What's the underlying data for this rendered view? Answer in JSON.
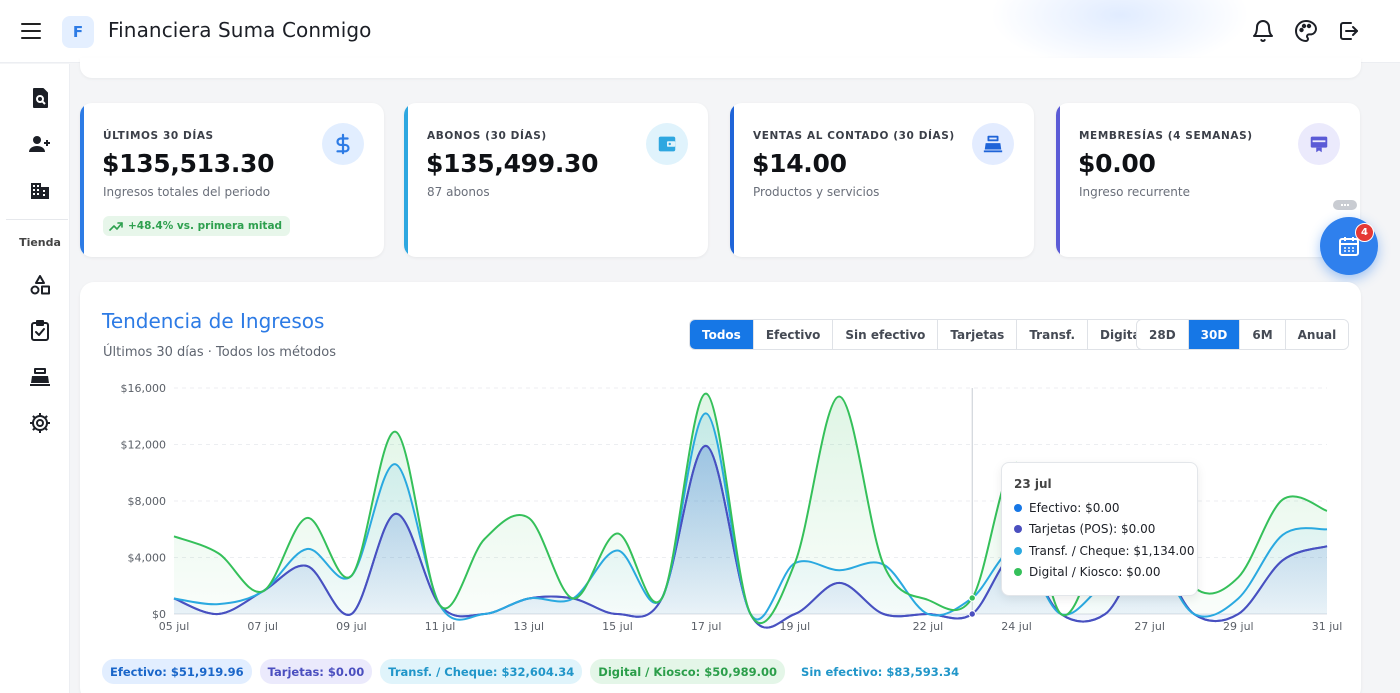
{
  "app": {
    "logo_letter": "F",
    "title": "Financiera Suma Conmigo"
  },
  "topbar": {
    "icons": [
      "bell-icon",
      "palette-icon",
      "logout-icon"
    ]
  },
  "sidebar": {
    "items_top": [
      "search-document-icon",
      "add-user-icon",
      "building-icon"
    ],
    "section_label": "Tienda",
    "items_store": [
      "shapes-icon",
      "clipboard-check-icon",
      "cash-register-icon",
      "gear-icon"
    ]
  },
  "kpis": [
    {
      "label": "ÚLTIMOS 30 DÍAS",
      "value": "$135,513.30",
      "sub": "Ingresos totales del periodo",
      "trend": "+48.4% vs. primera mitad",
      "accent": "#2d7be5",
      "icon": "dollar-icon",
      "icon_bg": "#e2eeff",
      "icon_color": "#2d7be5"
    },
    {
      "label": "ABONOS (30 DÍAS)",
      "value": "$135,499.30",
      "sub": "87 abonos",
      "accent": "#2ea7e0",
      "icon": "wallet-icon",
      "icon_bg": "#e0f3fc",
      "icon_color": "#2ea7e0"
    },
    {
      "label": "VENTAS AL CONTADO (30 DÍAS)",
      "value": "$14.00",
      "sub": "Productos y servicios",
      "accent": "#1f64d8",
      "icon": "cash-register-icon",
      "icon_bg": "#e3ecff",
      "icon_color": "#1f64d8"
    },
    {
      "label": "MEMBRESÍAS (4 SEMANAS)",
      "value": "$0.00",
      "sub": "Ingreso recurrente",
      "accent": "#5b5bd6",
      "icon": "card-icon",
      "icon_bg": "#ebeafc",
      "icon_color": "#5b5bd6"
    }
  ],
  "fab": {
    "badge": "4",
    "icon": "calendar-icon"
  },
  "chart": {
    "title": "Tendencia de Ingresos",
    "subtitle": "Últimos 30 días · Todos los métodos",
    "filters": [
      "Todos",
      "Efectivo",
      "Sin efectivo",
      "Tarjetas",
      "Transf.",
      "Digital"
    ],
    "filter_active": "Todos",
    "ranges": [
      "28D",
      "30D",
      "6M",
      "Anual"
    ],
    "range_active": "30D",
    "tooltip": {
      "title": "23 jul",
      "rows": [
        {
          "label": "Efectivo: $0.00",
          "color": "#1677e6"
        },
        {
          "label": "Tarjetas (POS): $0.00",
          "color": "#4b4fbf"
        },
        {
          "label": "Transf. / Cheque: $1,134.00",
          "color": "#2aa9e0"
        },
        {
          "label": "Digital / Kiosco: $0.00",
          "color": "#35c05a"
        }
      ]
    },
    "chips": [
      {
        "label": "Efectivo: $51,919.96",
        "bg": "#e2eeff",
        "color": "#1a66c9"
      },
      {
        "label": "Tarjetas: $0.00",
        "bg": "#ebeafc",
        "color": "#4b4fbf"
      },
      {
        "label": "Transf. / Cheque: $32,604.34",
        "bg": "#e0f4fb",
        "color": "#2196c9"
      },
      {
        "label": "Digital / Kiosco: $50,989.00",
        "bg": "#e4f6e8",
        "color": "#2b9e4a"
      },
      {
        "label": "Sin efectivo: $83,593.34",
        "bg": "#ffffff",
        "color": "#2196c9"
      }
    ]
  },
  "chart_data": {
    "type": "area",
    "x": [
      "05 jul",
      "06 jul",
      "07 jul",
      "08 jul",
      "09 jul",
      "10 jul",
      "11 jul",
      "12 jul",
      "13 jul",
      "14 jul",
      "15 jul",
      "16 jul",
      "17 jul",
      "18 jul",
      "19 jul",
      "20 jul",
      "21 jul",
      "22 jul",
      "23 jul",
      "24 jul",
      "25 jul",
      "26 jul",
      "27 jul",
      "28 jul",
      "29 jul",
      "30 jul",
      "31 jul"
    ],
    "xticks": [
      "05 jul",
      "07 jul",
      "09 jul",
      "11 jul",
      "13 jul",
      "15 jul",
      "17 jul",
      "19 jul",
      "22 jul",
      "24 jul",
      "27 jul",
      "29 jul",
      "31 jul"
    ],
    "yticks": [
      "$0",
      "$4,000",
      "$8,000",
      "$12,000",
      "$16,000"
    ],
    "ylim": [
      0,
      16000
    ],
    "grid": true,
    "stacked": true,
    "series": [
      {
        "name": "Efectivo",
        "color": "#1677e6",
        "values": [
          1100,
          0,
          1600,
          3400,
          0,
          7100,
          600,
          0,
          1100,
          1100,
          0,
          1100,
          11900,
          0,
          0,
          2200,
          0,
          0,
          0,
          4300,
          0,
          0,
          4300,
          0,
          0,
          3800,
          4800
        ]
      },
      {
        "name": "Tarjetas (POS)",
        "color": "#4b4fbf",
        "values": [
          0,
          0,
          0,
          0,
          0,
          0,
          0,
          0,
          0,
          0,
          0,
          0,
          0,
          0,
          0,
          0,
          0,
          0,
          0,
          0,
          0,
          0,
          0,
          0,
          0,
          0,
          0
        ]
      },
      {
        "name": "Transf. / Cheque",
        "color": "#2aa9e0",
        "values": [
          0,
          700,
          0,
          1200,
          2700,
          3500,
          0,
          0,
          0,
          0,
          4500,
          0,
          2300,
          0,
          3600,
          900,
          3500,
          0,
          1134,
          300,
          0,
          2200,
          0,
          0,
          1100,
          1800,
          1200
        ]
      },
      {
        "name": "Digital / Kiosco",
        "color": "#35c05a",
        "values": [
          4400,
          3600,
          0,
          2200,
          0,
          2300,
          0,
          5300,
          5700,
          0,
          1200,
          0,
          1400,
          0,
          0,
          12300,
          0,
          1000,
          0,
          6100,
          0,
          3400,
          3800,
          1900,
          1500,
          2500,
          1300
        ]
      }
    ],
    "hover_index": 18
  }
}
